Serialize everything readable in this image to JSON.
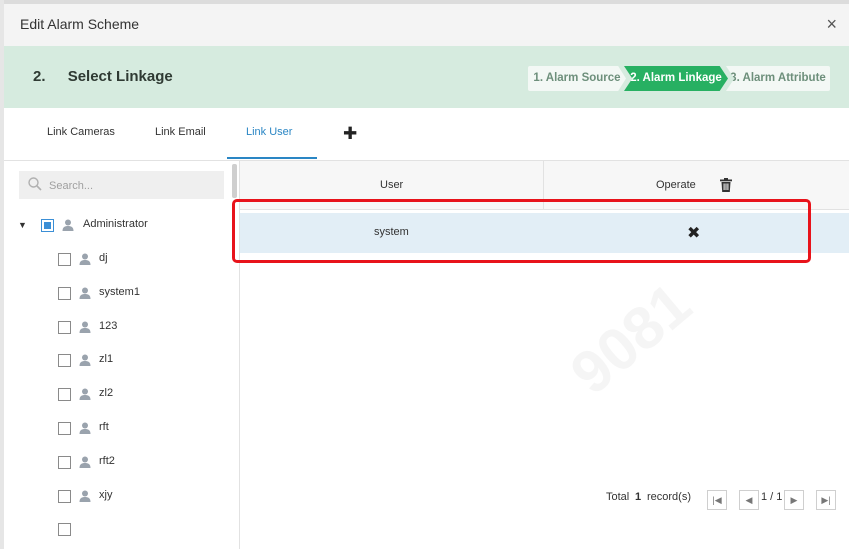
{
  "dialog": {
    "title": "Edit Alarm Scheme",
    "close_label": "×"
  },
  "stepbar": {
    "number": "2.",
    "heading": "Select Linkage",
    "steps": [
      {
        "label": "1. Alarm Source",
        "active": false
      },
      {
        "label": "2. Alarm Linkage",
        "active": true
      },
      {
        "label": "3. Alarm Attribute",
        "active": false
      }
    ]
  },
  "tabs": {
    "items": [
      "Link Cameras",
      "Link Email",
      "Link User"
    ],
    "active": "Link User",
    "add_label": "✚"
  },
  "search": {
    "placeholder": "Search..."
  },
  "tree": {
    "root": "Administrator",
    "root_state": "partial",
    "children": [
      "dj",
      "system1",
      "123",
      "zl1",
      "zl2",
      "rft",
      "rft2",
      "xjy"
    ]
  },
  "table": {
    "columns": [
      "User",
      "Operate"
    ],
    "rows": [
      {
        "user": "system",
        "operate": "✖"
      }
    ]
  },
  "pager": {
    "total_label": "Total",
    "total_count": "1",
    "records_label": "record(s)",
    "page_display": "1 / 1"
  },
  "colors": {
    "active_step": "#27b062",
    "active_tab": "#2a86c4",
    "highlight": "#e8131b",
    "selected_row": "#e2eef6"
  }
}
